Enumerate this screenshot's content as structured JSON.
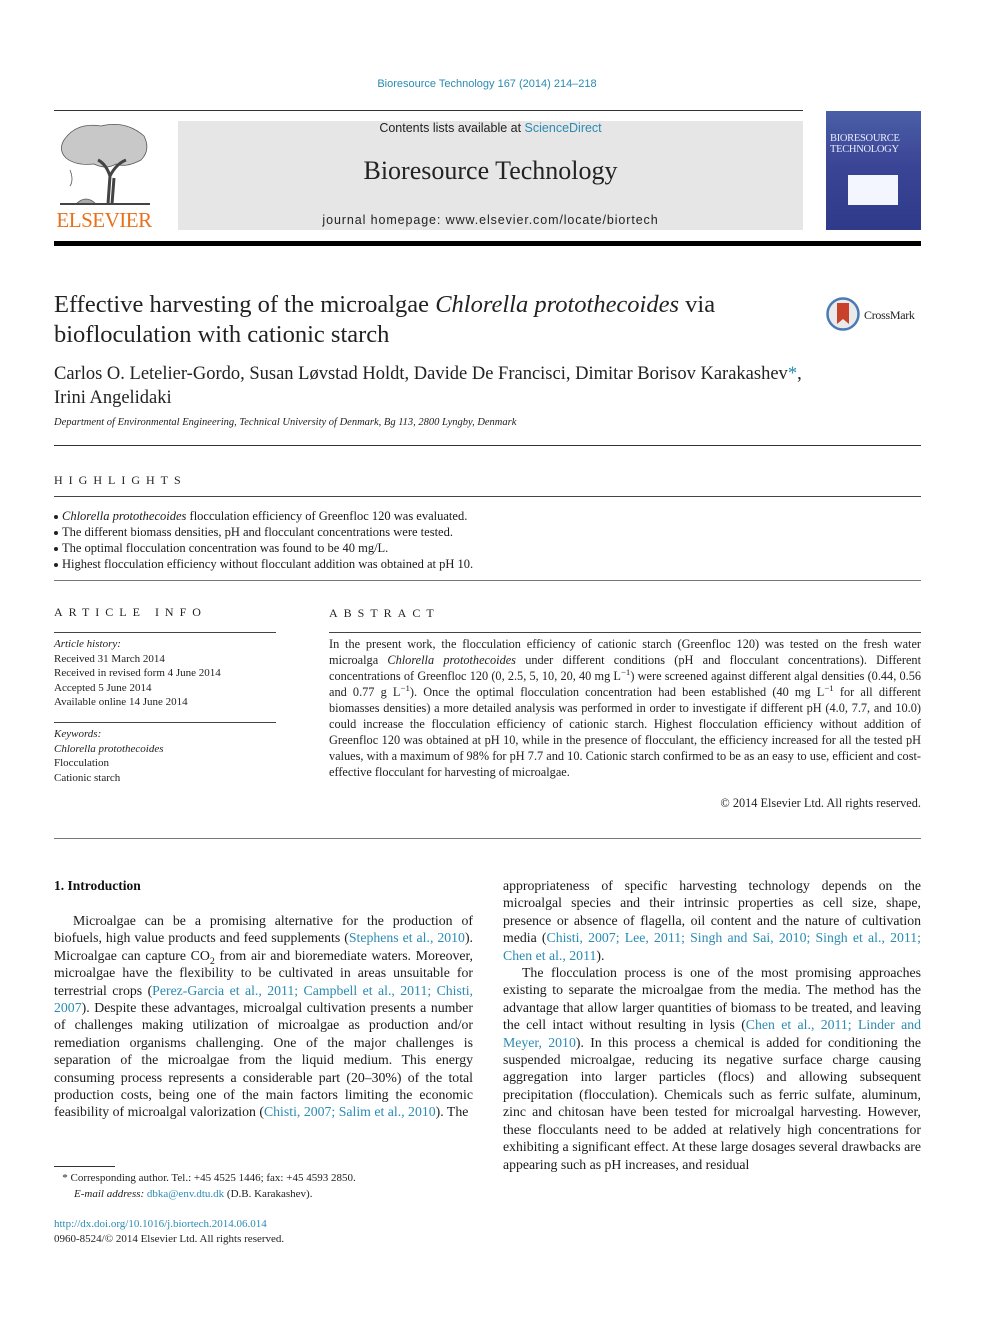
{
  "header": {
    "citation": "Bioresource Technology 167 (2014) 214–218",
    "contents_prefix": "Contents lists available at ",
    "contents_link": "ScienceDirect",
    "journal_name": "Bioresource Technology",
    "homepage": "journal homepage: www.elsevier.com/locate/biortech",
    "publisher_logo_text": "ELSEVIER",
    "cover_title_line1": "BIORESOURCE",
    "cover_title_line2": "TECHNOLOGY",
    "colors": {
      "link": "#2a8bb3",
      "elsevier_orange": "#e9711c",
      "banner_bg": "#e6e6e6",
      "cover_blue": "#3b4596"
    }
  },
  "article": {
    "title_part1": "Effective harvesting of the microalgae ",
    "title_italic": "Chlorella protothecoides",
    "title_part2": " via biofloculation with cationic starch",
    "crossmark_label": "CrossMark",
    "authors_line1": "Carlos O. Letelier-Gordo, Susan Løvstad Holdt, Davide De Francisci, Dimitar Borisov Karakashev",
    "author_star": "*",
    "authors_sep": ",",
    "authors_line2": "Irini Angelidaki",
    "affiliation": "Department of Environmental Engineering, Technical University of Denmark, Bg 113, 2800 Lyngby, Denmark"
  },
  "highlights": {
    "heading": "HIGHLIGHTS",
    "item0_italic": "Chlorella protothecoides",
    "item0_rest": " flocculation efficiency of Greenfloc 120 was evaluated.",
    "item1": "The different biomass densities, pH and flocculant concentrations were tested.",
    "item2": "The optimal flocculation concentration was found to be 40 mg/L.",
    "item3": "Highest flocculation efficiency without flocculant addition was obtained at pH 10."
  },
  "article_info": {
    "heading": "ARTICLE INFO",
    "history_label": "Article history:",
    "history": [
      "Received 31 March 2014",
      "Received in revised form 4 June 2014",
      "Accepted 5 June 2014",
      "Available online 14 June 2014"
    ],
    "keywords_label": "Keywords:",
    "keyword0": "Chlorella protothecoides",
    "keyword1": "Flocculation",
    "keyword2": "Cationic starch"
  },
  "abstract": {
    "heading": "ABSTRACT",
    "t1": "In the present work, the flocculation efficiency of cationic starch (Greenfloc 120) was tested on the fresh water microalga ",
    "t1_italic": "Chlorella protothecoides",
    "t2": " under different conditions (pH and flocculant concentrations). Different concentrations of Greenfloc 120 (0, 2.5, 5, 10, 20, 40 mg L",
    "sup_neg1": "−1",
    "t3": ") were screened against different algal densities (0.44, 0.56 and 0.77 g L",
    "t4": "). Once the optimal flocculation concentration had been established (40 mg L",
    "t5": " for all different biomasses densities) a more detailed analysis was performed in order to investigate if different pH (4.0, 7.7, and 10.0) could increase the flocculation efficiency of cationic starch. Highest flocculation efficiency without addition of Greenfloc 120 was obtained at pH 10, while in the presence of flocculant, the efficiency increased for all the tested pH values, with a maximum of 98% for pH 7.7 and 10. Cationic starch confirmed to be as an easy to use, efficient and cost-effective flocculant for harvesting of microalgae.",
    "copyright": "© 2014 Elsevier Ltd. All rights reserved."
  },
  "introduction": {
    "heading": "1. Introduction",
    "p1_a": "Microalgae can be a promising alternative for the production of biofuels, high value products and feed supplements (",
    "p1_ref1": "Stephens et al., 2010",
    "p1_b": "). Microalgae can capture CO",
    "p1_sub": "2",
    "p1_c": " from air and bioremediate waters. Moreover, microalgae have the flexibility to be cultivated in areas unsuitable for terrestrial crops (",
    "p1_ref2": "Perez-Garcia et al., 2011; Campbell et al., 2011; Chisti, 2007",
    "p1_d": "). Despite these advantages, microalgal cultivation presents a number of challenges making utilization of microalgae as production and/or remediation organisms challenging. One of the major challenges is separation of the microalgae from the liquid medium. This energy consuming process represents a considerable part (20–30%) of the total production costs, being one of the main factors limiting the economic feasibility of microalgal valorization (",
    "p1_ref3": "Chisti, 2007; Salim et al., 2010",
    "p1_e": "). The",
    "c2_a": "appropriateness of specific harvesting technology depends on the microalgal species and their intrinsic properties as cell size, shape, presence or absence of flagella, oil content and the nature of cultivation media (",
    "c2_ref1": "Chisti, 2007; Lee, 2011; Singh and Sai, 2010; Singh et al., 2011; Chen et al., 2011",
    "c2_b": ").",
    "p2_a": "The flocculation process is one of the most promising approaches existing to separate the microalgae from the media. The method has the advantage that allow larger quantities of biomass to be treated, and leaving the cell intact without resulting in lysis (",
    "p2_ref": "Chen et al., 2011; Linder and Meyer, 2010",
    "p2_b": "). In this process a chemical is added for conditioning the suspended microalgae, reducing its negative surface charge causing aggregation into larger particles (flocs) and allowing subsequent precipitation (flocculation). Chemicals such as ferric sulfate, aluminum, zinc and chitosan have been tested for microalgal harvesting. However, these flocculants need to be added at relatively high concentrations for exhibiting a significant effect. At these large dosages several drawbacks are appearing such as pH increases, and residual"
  },
  "footnote": {
    "star": "*",
    "corresponding": " Corresponding author. Tel.: +45 4525 1446; fax: +45 4593 2850.",
    "email_label": "E-mail address:",
    "email": "dbka@env.dtu.dk",
    "email_suffix": " (D.B. Karakashev)."
  },
  "doi": {
    "url": "http://dx.doi.org/10.1016/j.biortech.2014.06.014",
    "issn": "0960-8524/© 2014 Elsevier Ltd. All rights reserved."
  }
}
